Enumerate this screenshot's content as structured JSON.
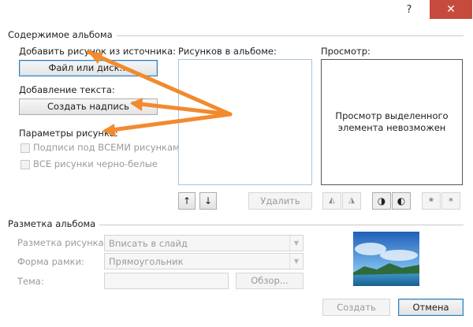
{
  "window": {
    "help_glyph": "?",
    "close_glyph": "✕"
  },
  "album_content": {
    "group_title": "Содержимое альбома",
    "insert_picture_label": "Добавить рисунок из источника:",
    "file_disk_button": "Файл или диск...",
    "insert_text_label": "Добавление текста:",
    "new_text_box_button": "Создать надпись",
    "picture_options_label": "Параметры рисунка:",
    "captions_checkbox": "Подписи под ВСЕМИ рисунками",
    "bw_checkbox": "ВСЕ рисунки черно-белые",
    "pictures_in_album_label": "Рисунков в альбоме:",
    "move_up_glyph": "↑",
    "move_down_glyph": "↓",
    "remove_button": "Удалить",
    "preview_label": "Просмотр:",
    "preview_message": "Просмотр выделенного элемента невозможен",
    "tool_icons": [
      "rotate-left-icon",
      "rotate-right-icon",
      "contrast-increase-icon",
      "contrast-decrease-icon",
      "brightness-increase-icon",
      "brightness-decrease-icon"
    ]
  },
  "album_layout": {
    "group_title": "Разметка альбома",
    "picture_layout_label": "Разметка рисунка:",
    "picture_layout_value": "Вписать в слайд",
    "frame_shape_label": "Форма рамки:",
    "frame_shape_value": "Прямоугольник",
    "theme_label": "Тема:",
    "browse_button": "Обзор..."
  },
  "footer": {
    "create_button": "Создать",
    "cancel_button": "Отмена"
  },
  "colors": {
    "arrow": "#f28a2e",
    "close_button": "#c74b3c",
    "focus_border": "#3c7fb1"
  }
}
